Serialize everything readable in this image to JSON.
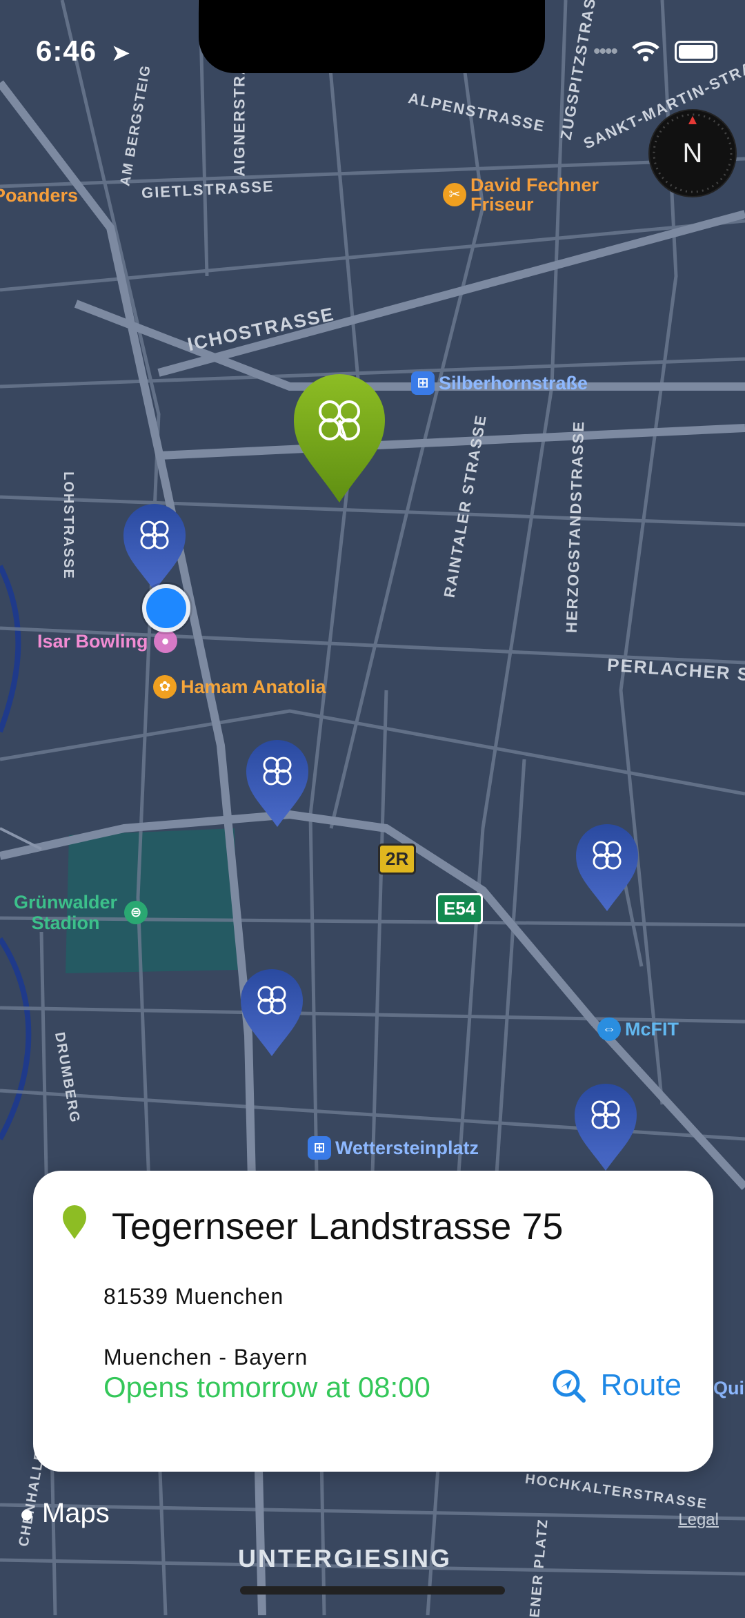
{
  "status_bar": {
    "time": "6:46"
  },
  "compass": {
    "label": "N"
  },
  "map": {
    "streets": [
      "ALPENSTRASSE",
      "GIETLSTRASSE",
      "ICHOSTRASSE",
      "AIGNERSTRASSE",
      "AM BERGSTEIG",
      "ZUGSPITZSTRASSE",
      "SANKT-MARTIN-STRA",
      "RAINTALER STRASSE",
      "HERZOGSTANDSTRASSE",
      "LOHSTRASSE",
      "PERLACHER S",
      "DRUMBERG",
      "HOCHKALTERSTRASSE",
      "CHENHALLER S",
      "ENER PLATZ"
    ],
    "pois": {
      "david_fechner": "David Fechner\nFriseur",
      "silberhorn": "Silberhornstraße",
      "isar_bowling": "Isar Bowling",
      "hamam": "Hamam Anatolia",
      "stadion": "Grünwalder\nStadion",
      "mcfit": "McFIT",
      "wettersteinplatz": "Wettersteinplatz",
      "poanders": "Poanders",
      "quick": "Qui"
    },
    "road_shields": {
      "r2": "2R",
      "e54": "E54"
    },
    "district": "UNTERGIESING",
    "attribution_logo": "Maps",
    "legal": "Legal",
    "colors": {
      "selected_pin": "#7aa820",
      "store_pin": "#2a4aa0",
      "user_location": "#1e88ff"
    }
  },
  "card": {
    "title": "Tegernseer Landstrasse 75",
    "postal": "81539 Muenchen",
    "region": "Muenchen - Bayern",
    "hours": "Opens tomorrow at 08:00",
    "route_label": "Route",
    "hours_color": "#34c759",
    "accent": "#1e88e5"
  }
}
